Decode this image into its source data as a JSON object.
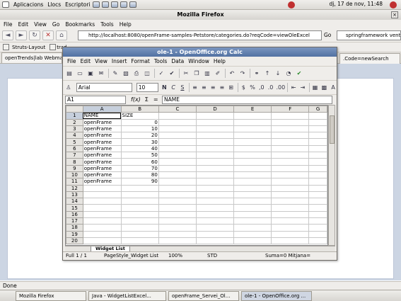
{
  "gnome_panel": {
    "menus": [
      "Aplicacions",
      "Llocs",
      "Escriptori"
    ],
    "clock": "dj, 17 de nov, 11:48"
  },
  "firefox": {
    "title": "Mozilla Firefox",
    "menu": [
      "File",
      "Edit",
      "View",
      "Go",
      "Bookmarks",
      "Tools",
      "Help"
    ],
    "url": "http://localhost:8080/openFrame-samples-Petstore/categories.do?reqCode=viewOleExcel",
    "go_label": "Go",
    "search_value": "springframework venta",
    "bookmarks": [
      "Struts-Layout",
      "trad"
    ],
    "tabs": [
      "openTrends|lab Webmail",
      ".Code=newSearch"
    ],
    "status": "Done"
  },
  "calc": {
    "title": "ole-1 - OpenOffice.org Calc",
    "menu": [
      "File",
      "Edit",
      "View",
      "Insert",
      "Format",
      "Tools",
      "Data",
      "Window",
      "Help"
    ],
    "font_name": "Arial",
    "font_size": "10",
    "bold": "N",
    "italic": "C",
    "underline": "S",
    "name_box": "A1",
    "formula_fx": "f(x)",
    "formula_sigma": "Σ",
    "formula_eq": "=",
    "formula_value": "NAME",
    "columns": [
      "A",
      "B",
      "C",
      "D",
      "E",
      "F",
      "G"
    ],
    "row_numbers": [
      "1",
      "2",
      "3",
      "4",
      "5",
      "6",
      "7",
      "8",
      "9",
      "10",
      "11",
      "12",
      "13",
      "14",
      "15",
      "16",
      "17",
      "18",
      "19",
      "20"
    ],
    "rows": [
      [
        "NAME",
        "SIZE"
      ],
      [
        "openFrame",
        "0"
      ],
      [
        "openFrame",
        "10"
      ],
      [
        "openFrame",
        "20"
      ],
      [
        "openFrame",
        "30"
      ],
      [
        "openFrame",
        "40"
      ],
      [
        "openFrame",
        "50"
      ],
      [
        "openFrame",
        "60"
      ],
      [
        "openFrame",
        "70"
      ],
      [
        "openFrame",
        "80"
      ],
      [
        "openFrame",
        "90"
      ]
    ],
    "sheet_tab": "Widget List",
    "status": {
      "sheet": "Full 1 / 1",
      "style": "PageStyle_Widget List",
      "zoom": "100%",
      "mode": "STD",
      "sum": "Suma=0 Mitjana="
    }
  },
  "taskbar": [
    "Mozilla Firefox",
    "Java - WidgetListExcel...",
    "openFrame_Servei_Ol...",
    "ole-1 - OpenOffice.org ..."
  ]
}
